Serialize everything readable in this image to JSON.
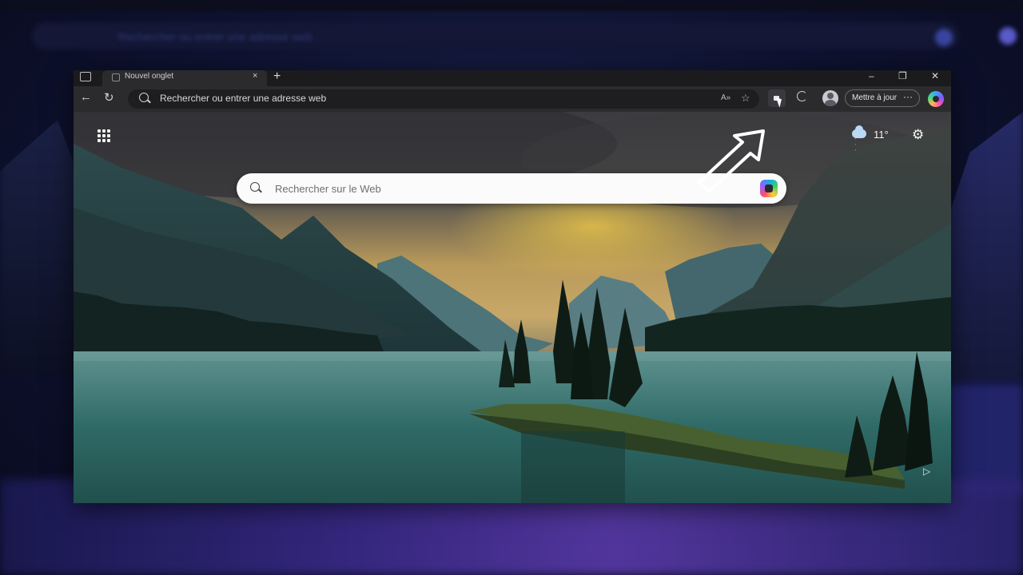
{
  "browser": {
    "tab": {
      "title": "Nouvel onglet",
      "close": "×"
    },
    "new_tab": "+",
    "window_controls": {
      "minimize": "–",
      "restore": "❐",
      "close": "✕"
    }
  },
  "toolbar": {
    "back": "←",
    "refresh": "↻",
    "address_placeholder": "Rechercher ou entrer une adresse web",
    "read_aloud": "A»",
    "favorite": "☆",
    "update_label": "Mettre à jour",
    "more": "···"
  },
  "newtab": {
    "search_placeholder": "Rechercher sur le Web",
    "weather": {
      "temperature": "11°"
    },
    "settings_icon": "⚙",
    "play_icon": "▷"
  },
  "backdrop": {
    "url_text": "Rechercher ou entrer une adresse web"
  },
  "icons": [
    "app-launcher-icon",
    "weather-icon",
    "settings-icon",
    "search-icon",
    "visual-search-icon",
    "copilot-icon",
    "extensions-icon",
    "profile-icon",
    "arrow-annotation-icon"
  ]
}
